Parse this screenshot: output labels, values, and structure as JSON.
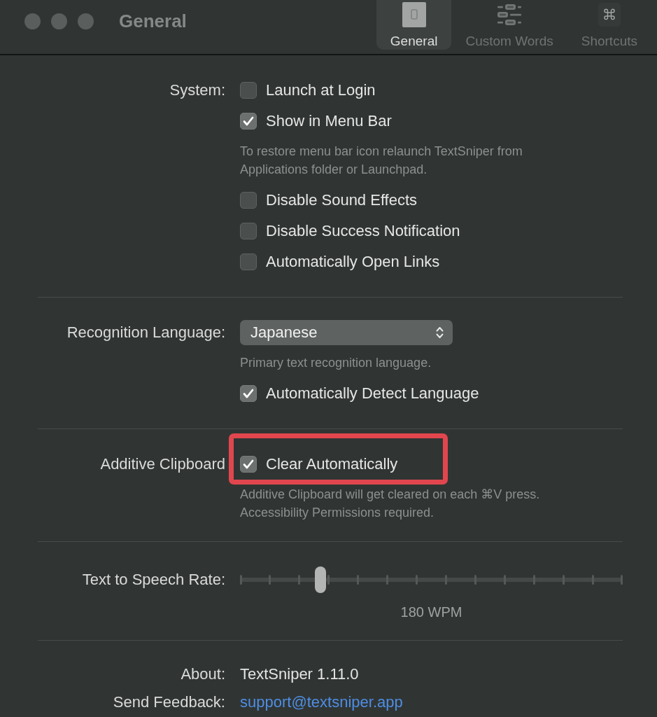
{
  "window": {
    "title": "General"
  },
  "toolbar": [
    {
      "label": "General",
      "selected": true
    },
    {
      "label": "Custom Words",
      "selected": false
    },
    {
      "label": "Shortcuts",
      "selected": false
    }
  ],
  "sections": [
    {
      "rows": [
        {
          "label": "System:",
          "items": [
            {
              "kind": "checkbox",
              "label": "Launch at Login",
              "checked": false
            },
            {
              "kind": "checkbox",
              "label": "Show in Menu Bar",
              "checked": true
            },
            {
              "kind": "note",
              "text": "To restore menu bar icon relaunch TextSniper from\nApplications folder or Launchpad."
            },
            {
              "kind": "checkbox",
              "label": "Disable Sound Effects",
              "checked": false
            },
            {
              "kind": "checkbox",
              "label": "Disable Success Notification",
              "checked": false
            },
            {
              "kind": "checkbox",
              "label": "Automatically Open Links",
              "checked": false
            }
          ]
        }
      ]
    },
    {
      "rows": [
        {
          "label": "Recognition Language:",
          "items": [
            {
              "kind": "popup",
              "value": "Japanese"
            },
            {
              "kind": "note",
              "text": "Primary text recognition language."
            },
            {
              "kind": "checkbox",
              "label": "Automatically Detect Language",
              "checked": true
            }
          ]
        }
      ]
    },
    {
      "rows": [
        {
          "label": "Additive Clipboard",
          "items": [
            {
              "kind": "checkbox",
              "label": "Clear Automatically",
              "checked": true,
              "highlighted": true
            },
            {
              "kind": "note",
              "text": "Additive Clipboard will get cleared on each ⌘V press.\nAccessibility Permissions required."
            }
          ]
        }
      ]
    },
    {
      "rows": [
        {
          "label": "Text to Speech Rate:",
          "items": [
            {
              "kind": "slider",
              "level": 0.21,
              "reading": "180 WPM"
            }
          ]
        }
      ]
    },
    {
      "rows": [
        {
          "label": "About:",
          "items": [
            {
              "kind": "text",
              "text": "TextSniper 1.11.0"
            }
          ]
        },
        {
          "label": "Send Feedback:",
          "items": [
            {
              "kind": "link",
              "text": "support@textsniper.app"
            }
          ]
        }
      ]
    }
  ]
}
